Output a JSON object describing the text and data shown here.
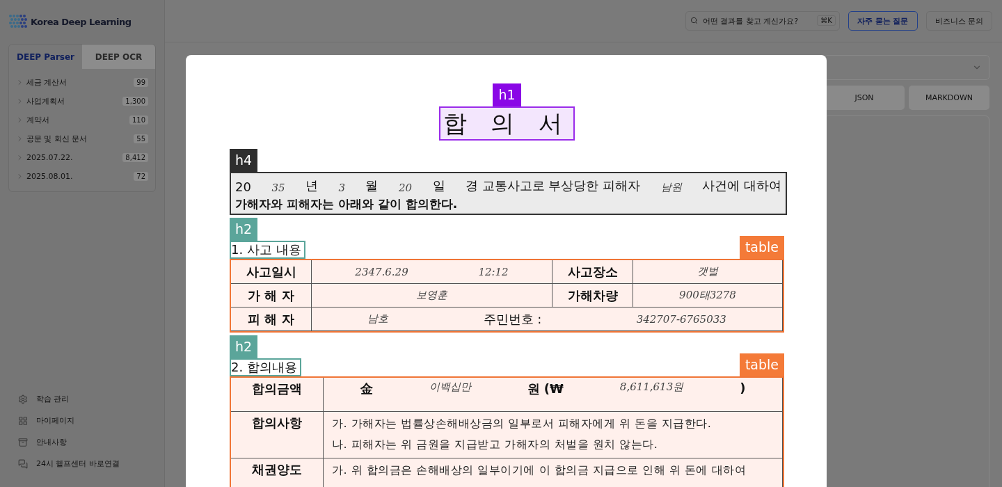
{
  "app": {
    "logo": {
      "name": "Korea Deep Learning"
    },
    "sidebar": {
      "tabs": [
        {
          "label": "DEEP Parser",
          "selected": true
        },
        {
          "label": "DEEP OCR",
          "selected": false
        }
      ],
      "folders": [
        {
          "label": "세금 계산서",
          "count": "99"
        },
        {
          "label": "사업계획서",
          "count": "1,300"
        },
        {
          "label": "계약서",
          "count": "110"
        },
        {
          "label": "공문 및 회신 문서",
          "count": "55"
        },
        {
          "label": "2025.07.22.",
          "count": "8,412"
        },
        {
          "label": "2025.08.01.",
          "count": "72"
        }
      ],
      "menu": [
        {
          "kind": "gear",
          "label": "학습 관리"
        },
        {
          "kind": "grid",
          "label": "마이페이지"
        },
        {
          "kind": "box",
          "label": "안내사항"
        },
        {
          "kind": "chat",
          "label": "24시 헬프센터 바로연결"
        }
      ]
    },
    "header": {
      "search": {
        "placeholder": "어떤 결과를 찾고 계신가요?",
        "shortcut": "⌘K"
      },
      "buttons": [
        {
          "label": "자주 묻는 질문",
          "kind": "primary"
        },
        {
          "label": "비즈니스 문의",
          "kind": "plain"
        }
      ]
    },
    "formats": [
      {
        "label": "JSON"
      },
      {
        "label": "MARKDOWN"
      }
    ]
  },
  "document": {
    "title": {
      "tag": "h1",
      "text": "합 의 서"
    },
    "intro": {
      "tag": "h4",
      "line1": [
        {
          "kind": "print",
          "text": "20"
        },
        {
          "kind": "hand",
          "text": "35"
        },
        {
          "kind": "print",
          "text": "년"
        },
        {
          "kind": "hand",
          "text": "3"
        },
        {
          "kind": "print",
          "text": "월"
        },
        {
          "kind": "hand",
          "text": "20"
        },
        {
          "kind": "print",
          "text": "일"
        },
        {
          "kind": "print",
          "text": "경 교통사고로 부상당한 피해자"
        },
        {
          "kind": "hand",
          "text": "남원"
        },
        {
          "kind": "print",
          "text": "사건에 대하여"
        }
      ],
      "line2": "가해자와 피해자는 아래와 같이 합의한다."
    },
    "sections": [
      {
        "tag": "h2",
        "heading": "1. 사고 내용",
        "table_tag": "table",
        "rows": [
          [
            {
              "kind": "label",
              "text": "사고일시"
            },
            {
              "kind": "parts",
              "parts": [
                {
                  "kind": "hand",
                  "text": "2347.6.29"
                },
                {
                  "kind": "hand",
                  "text": "12:12"
                }
              ]
            },
            {
              "kind": "label",
              "text": "사고장소"
            },
            {
              "kind": "parts",
              "parts": [
                {
                  "kind": "hand",
                  "text": "갯벌"
                }
              ]
            }
          ],
          [
            {
              "kind": "label",
              "text": "가 해 자"
            },
            {
              "kind": "parts",
              "parts": [
                {
                  "kind": "hand",
                  "text": "보영훈"
                }
              ]
            },
            {
              "kind": "label",
              "text": "가해차량"
            },
            {
              "kind": "parts",
              "parts": [
                {
                  "kind": "hand",
                  "text": "900태3278"
                }
              ]
            }
          ],
          [
            {
              "kind": "label",
              "text": "피 해 자"
            },
            {
              "kind": "parts",
              "parts": [
                {
                  "kind": "hand",
                  "text": "남호"
                },
                {
                  "kind": "print",
                  "text": "주민번호 :"
                },
                {
                  "kind": "hand",
                  "text": "342707-6765033"
                }
              ]
            }
          ]
        ]
      },
      {
        "tag": "h2",
        "heading": "2. 합의내용",
        "table_tag": "table",
        "rows": [
          [
            {
              "kind": "label",
              "text": "합의금액"
            },
            {
              "kind": "parts",
              "parts": [
                {
                  "kind": "bold",
                  "text": "金"
                },
                {
                  "kind": "hand",
                  "text": "이백십만"
                },
                {
                  "kind": "bold",
                  "text": "원 (₩"
                },
                {
                  "kind": "hand",
                  "text": "8,611,613원"
                },
                {
                  "kind": "bold",
                  "text": ")"
                }
              ]
            }
          ],
          [
            {
              "kind": "label",
              "text": "합의사항"
            },
            {
              "kind": "lines",
              "lines": [
                "가.  가해자는 법률상손해배상금의 일부로서 피해자에게 위 돈을 지급한다.",
                "나. 피해자는 위 금원을 지급받고 가해자의 처벌을 원치 않는다."
              ]
            }
          ],
          [
            {
              "kind": "label",
              "text": "채권양도"
            },
            {
              "kind": "lines",
              "lines": [
                "가. 위 합의금은 손해배상의 일부이기에 이 합의금 지급으로 인해 위 돈에 대하여"
              ]
            }
          ]
        ]
      }
    ]
  }
}
